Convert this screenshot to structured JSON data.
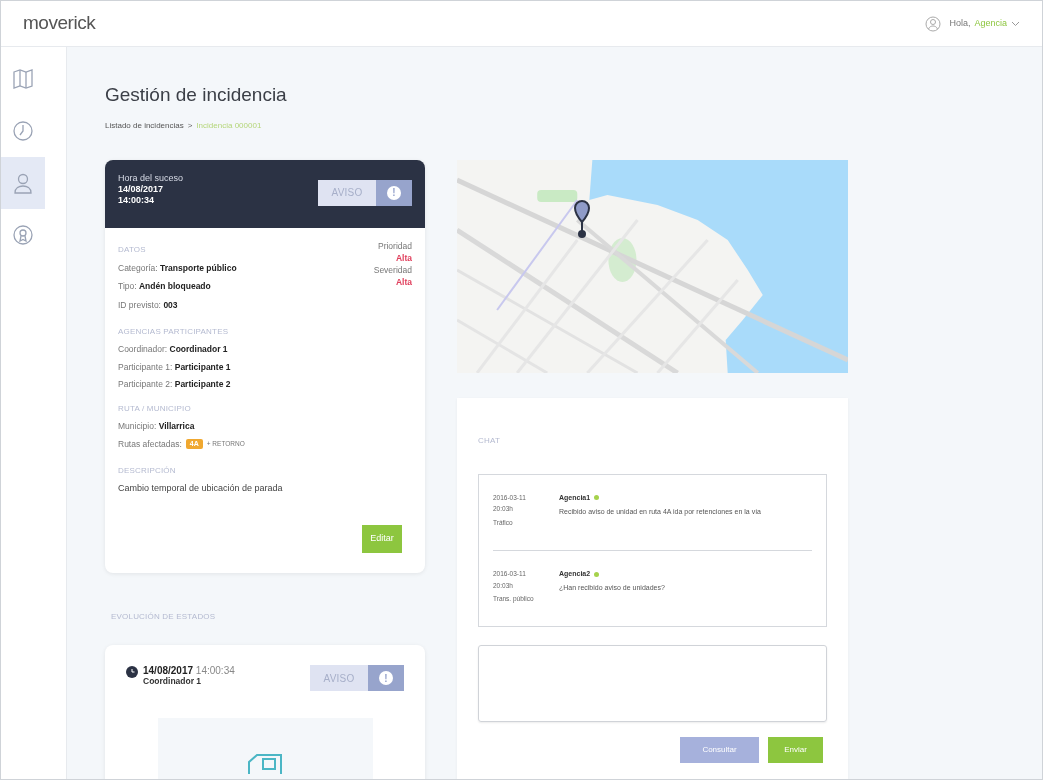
{
  "header": {
    "logo": "moverick",
    "greeting": "Hola,",
    "user": "Agencia"
  },
  "sidebar": {
    "items": [
      {
        "kind": "map",
        "selected": false
      },
      {
        "kind": "clock",
        "selected": false
      },
      {
        "kind": "person",
        "selected": true
      },
      {
        "kind": "medal",
        "selected": false
      }
    ]
  },
  "page": {
    "title": "Gestión de incidencia",
    "breadcrumb": [
      {
        "label": "Listado de incidencias",
        "current": false
      },
      {
        "label": "Incidencia 000001",
        "current": true
      }
    ],
    "separator": ">"
  },
  "incident": {
    "time_label": "Hora del suceso",
    "date": "14/08/2017",
    "time": "14:00:34",
    "status": "AVISO",
    "status_icon": "!",
    "datos_title": "DATOS",
    "fields": [
      {
        "label": "Categoría:",
        "value": "Transporte público"
      },
      {
        "label": "Tipo:",
        "value": "Andén bloqueado"
      },
      {
        "label": "ID previsto:",
        "value": "003"
      }
    ],
    "levels": [
      {
        "label": "Prioridad",
        "value": "Alta"
      },
      {
        "label": "Severidad",
        "value": "Alta"
      }
    ],
    "agencies_title": "AGENCIAS PARTICIPANTES",
    "agencies": [
      {
        "label": "Coordinador:",
        "value": "Coordinador 1"
      },
      {
        "label": "Participante 1:",
        "value": "Participante 1"
      },
      {
        "label": "Participante 2:",
        "value": "Participante 2"
      }
    ],
    "route_title": "RUTA / MUNICIPIO",
    "municipio_label": "Municipio:",
    "municipio": "Villarrica",
    "routes_label": "Rutas afectadas:",
    "route_badge": "4A",
    "route_extra": "+ RETORNO",
    "description_title": "DESCRIPCIÓN",
    "description": "Cambio temporal de ubicación de parada",
    "edit_button": "Editar"
  },
  "evolution": {
    "title": "EVOLUCIÓN DE ESTADOS",
    "entries": [
      {
        "date": "14/08/2017",
        "time": "14:00:34",
        "author": "Coordinador 1",
        "status": "AVISO",
        "status_icon": "!"
      }
    ]
  },
  "chat": {
    "title": "CHAT",
    "messages": [
      {
        "date": "2016-03-11",
        "time": "20:03h",
        "channel": "Tráfico",
        "sender": "Agencia1",
        "text": "Recibido aviso de unidad en ruta 4A ida por retenciones en la vía"
      },
      {
        "date": "2016-03-11",
        "time": "20:03h",
        "channel": "Trans. público",
        "sender": "Agencia2",
        "text": "¿Han recibido aviso de unidades?"
      }
    ],
    "buttons": [
      {
        "label": "Consultar",
        "kind": "secondary"
      },
      {
        "label": "Enviar",
        "kind": "primary"
      }
    ]
  }
}
